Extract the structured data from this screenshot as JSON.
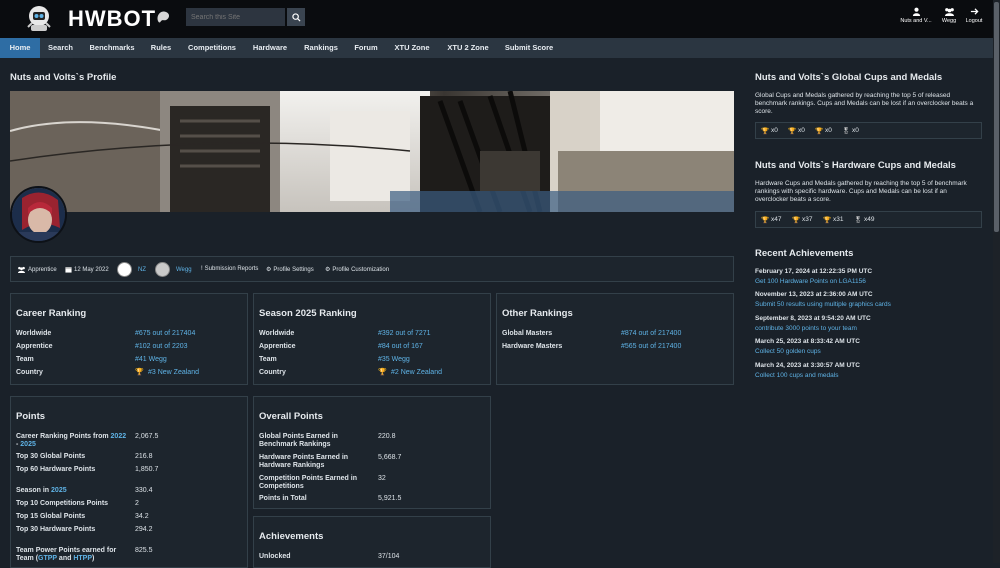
{
  "header": {
    "logo_text": "HWBOT",
    "search_placeholder": "Search this Site",
    "user_label": "Nuts and V...",
    "team_label": "Wegg",
    "logout_label": "Logout"
  },
  "nav": [
    "Home",
    "Search",
    "Benchmarks",
    "Rules",
    "Competitions",
    "Hardware",
    "Rankings",
    "Forum",
    "XTU Zone",
    "XTU 2 Zone",
    "Submit Score"
  ],
  "profile": {
    "title": "Nuts and Volts`s Profile",
    "league": "Apprentice",
    "joined": "12 May 2022",
    "country": "NZ",
    "team": "Wegg",
    "submission_reports": "Submission Reports",
    "profile_settings": "Profile Settings",
    "profile_customization": "Profile Customization"
  },
  "career": {
    "title": "Career Ranking",
    "rows": [
      {
        "label": "Worldwide",
        "value": "#675 out of 217404"
      },
      {
        "label": "Apprentice",
        "value": "#102 out of 2203"
      },
      {
        "label": "Team",
        "value": "#41 Wegg"
      },
      {
        "label": "Country",
        "value": "#3 New Zealand"
      }
    ]
  },
  "season": {
    "title": "Season 2025 Ranking",
    "rows": [
      {
        "label": "Worldwide",
        "value": "#392 out of 7271"
      },
      {
        "label": "Apprentice",
        "value": "#84 out of 167"
      },
      {
        "label": "Team",
        "value": "#35 Wegg"
      },
      {
        "label": "Country",
        "value": "#2 New Zealand"
      }
    ]
  },
  "other": {
    "title": "Other Rankings",
    "rows": [
      {
        "label": "Global Masters",
        "value": "#874 out of 217400"
      },
      {
        "label": "Hardware Masters",
        "value": "#565 out of 217400"
      }
    ]
  },
  "points": {
    "title": "Points",
    "career_pre": "Career Ranking Points from",
    "career_y1": "2022",
    "career_dash": "- ",
    "career_y2": "2025",
    "career_val": "2,067.5",
    "top30g": "Top 30 Global Points",
    "top30g_val": "216.8",
    "top60h": "Top 60 Hardware Points",
    "top60h_val": "1,850.7",
    "season_pre": "Season in",
    "season_y": "2025",
    "season_val": "330.4",
    "top10c": "Top 10 Competitions Points",
    "top10c_val": "2",
    "top15g": "Top 15 Global Points",
    "top15g_val": "34.2",
    "top30h": "Top 30 Hardware Points",
    "top30h_val": "294.2",
    "team_pre": "Team Power Points earned for",
    "team_pre2": "Team (",
    "gtpp": "GTPP",
    "and": " and ",
    "htpp": "HTPP",
    "close": ")",
    "team_val": "825.5"
  },
  "overall": {
    "title": "Overall Points",
    "rows": [
      {
        "label": "Global Points Earned in Benchmark Rankings",
        "value": "220.8"
      },
      {
        "label": "Hardware Points Earned in Hardware Rankings",
        "value": "5,668.7"
      },
      {
        "label": "Competition Points Earned in Competitions",
        "value": "32"
      },
      {
        "label": "Points in Total",
        "value": "5,921.5"
      }
    ]
  },
  "achievements": {
    "title": "Achievements",
    "unlocked_label": "Unlocked",
    "unlocked_value": "37/104"
  },
  "global_cups": {
    "title": "Nuts and Volts`s Global Cups and Medals",
    "desc": "Global Cups and Medals gathered by reaching the top 5 of released benchmark rankings. Cups and Medals can be lost if an overclocker beats a score.",
    "counts": [
      "x0",
      "x0",
      "x0",
      "x0"
    ]
  },
  "hardware_cups": {
    "title": "Nuts and Volts`s Hardware Cups and Medals",
    "desc": "Hardware Cups and Medals gathered by reaching the top 5 of benchmark rankings with specific hardware. Cups and Medals can be lost if an overclocker beats a score.",
    "counts": [
      "x47",
      "x37",
      "x31",
      "x49"
    ]
  },
  "recent": {
    "title": "Recent Achievements",
    "items": [
      {
        "date": "February 17, 2024 at 12:22:35 PM UTC",
        "text": "Get 100 Hardware Points on LGA1156"
      },
      {
        "date": "November 13, 2023 at 2:36:00 AM UTC",
        "text": "Submit 50 results using multiple graphics cards"
      },
      {
        "date": "September 8, 2023 at 9:54:20 AM UTC",
        "text": "contribute 3000 points to your team"
      },
      {
        "date": "March 25, 2023 at 8:33:42 AM UTC",
        "text": "Collect 50 golden cups"
      },
      {
        "date": "March 24, 2023 at 3:30:57 AM UTC",
        "text": "Collect 100 cups and medals"
      }
    ]
  },
  "colors": {
    "accent": "#2e6da4",
    "link": "#5fb3e6",
    "gold": "#e8b422",
    "silver": "#c8ccd0",
    "bronze": "#c8913a"
  }
}
